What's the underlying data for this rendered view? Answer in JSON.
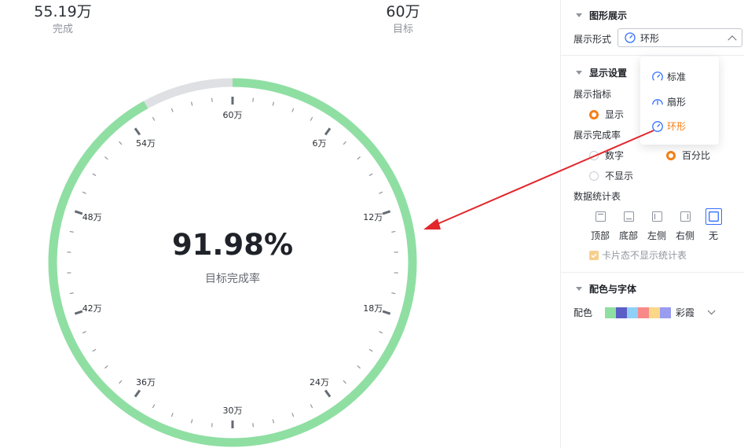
{
  "stats": {
    "done": {
      "value": "55.19万",
      "label": "完成"
    },
    "goal": {
      "value": "60万",
      "label": "目标"
    }
  },
  "gauge": {
    "percent_text": "91.98%",
    "caption": "目标完成率",
    "progress": 0.9198,
    "ticks": [
      "60万",
      "6万",
      "12万",
      "18万",
      "24万",
      "30万",
      "36万",
      "42万",
      "48万",
      "54万"
    ],
    "colors": {
      "progress": "#8fdfa3",
      "track": "#dee0e3",
      "tick": "#646a73"
    }
  },
  "panel": {
    "chart_section": "图形展示",
    "display_form_label": "展示形式",
    "display_form_value": "环形",
    "display_section": "显示设置",
    "show_metric_label": "展示指标",
    "show_metric_option": "显示",
    "completion_label": "展示完成率",
    "completion_options": [
      "数字",
      "百分比",
      "不显示"
    ],
    "stat_table_label": "数据统计表",
    "layout_options": [
      "顶部",
      "底部",
      "左侧",
      "右侧",
      "无"
    ],
    "card_checkbox": "卡片态不显示统计表",
    "color_section": "配色与字体",
    "palette_label": "配色",
    "palette_name": "彩霞",
    "palette_colors": [
      "#8fdfa3",
      "#5b5ec4",
      "#8fd0f8",
      "#f98989",
      "#fad888",
      "#9a9cf0"
    ],
    "accent": "#3370ff",
    "selected_color": "#f57f17"
  },
  "dropdown": {
    "options": [
      "标准",
      "扇形",
      "环形"
    ],
    "selected": "环形"
  }
}
